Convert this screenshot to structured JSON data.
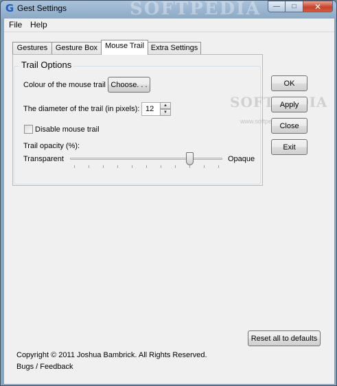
{
  "window": {
    "title": "Gest Settings",
    "icon_glyph": "G",
    "watermark": "SOFTPEDIA",
    "caption": {
      "minimize_glyph": "—",
      "maximize_glyph": "□",
      "close_glyph": "✕"
    }
  },
  "menu": {
    "items": [
      "File",
      "Help"
    ]
  },
  "tabs": [
    {
      "label": "Gestures",
      "active": false
    },
    {
      "label": "Gesture Box",
      "active": false
    },
    {
      "label": "Mouse Trail",
      "active": true
    },
    {
      "label": "Extra Settings",
      "active": false
    }
  ],
  "trail_options": {
    "group_title": "Trail Options",
    "colour_label": "Colour of the mouse trail",
    "choose_button": "Choose. . .",
    "diameter_label": "The diameter of the trail (in pixels):",
    "diameter_value": "12",
    "spin_up_glyph": "▲",
    "spin_down_glyph": "▼",
    "disable_label": "Disable mouse trail",
    "disable_checked": false,
    "opacity_label": "Trail opacity (%):",
    "slider_min_label": "Transparent",
    "slider_max_label": "Opaque",
    "opacity_fraction": 0.8
  },
  "side_buttons": {
    "ok": "OK",
    "apply": "Apply",
    "close": "Close",
    "exit": "Exit"
  },
  "watermark_body": {
    "brand": "SOFTPEDIA",
    "url": "www.softpedia.com"
  },
  "reset_button": "Reset all to defaults",
  "footer": {
    "copyright": "Copyright © 2011 Joshua Bambrick. All Rights Reserved.",
    "bugs_link": "Bugs / Feedback"
  }
}
